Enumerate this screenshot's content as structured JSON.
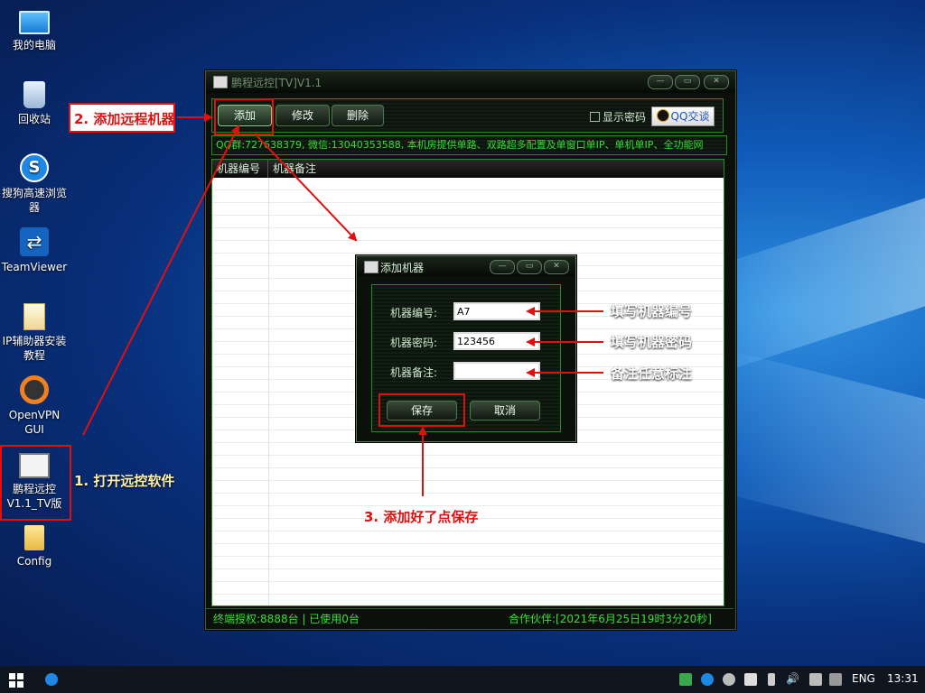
{
  "desktop": {
    "icons": [
      {
        "label": "我的电脑"
      },
      {
        "label": "回收站"
      },
      {
        "label": "搜狗高速浏览器"
      },
      {
        "label": "TeamViewer"
      },
      {
        "label": "IP辅助器安装教程"
      },
      {
        "label": "OpenVPN GUI"
      },
      {
        "label": "鹏程远控V1.1_TV版"
      },
      {
        "label": "Config"
      }
    ]
  },
  "main_window": {
    "title": "鹏程远控[TV]V1.1",
    "toolbar": {
      "add": "添加",
      "edit": "修改",
      "delete": "删除",
      "show_password": "显示密码",
      "qq_chat": "QQ交谈"
    },
    "marquee": "QQ群:727638379, 微信:13040353588, 本机房提供单路、双路超多配置及单窗口单IP、单机单IP、全功能网",
    "columns": [
      "机器编号",
      "机器备注"
    ],
    "status_left": "终端授权:8888台 | 已使用0台",
    "status_right": "合作伙伴:[2021年6月25日19时3分20秒]"
  },
  "dialog": {
    "title": "添加机器",
    "fields": [
      {
        "label": "机器编号:",
        "value": "A7"
      },
      {
        "label": "机器密码:",
        "value": "123456"
      },
      {
        "label": "机器备注:",
        "value": ""
      }
    ],
    "save": "保存",
    "cancel": "取消"
  },
  "annotations": {
    "step1": "1. 打开远控软件",
    "step2": "2. 添加远程机器",
    "step3": "3. 添加好了点保存",
    "fill_id": "填写机器编号",
    "fill_pwd": "填写机器密码",
    "fill_note": "备注任意标注"
  },
  "taskbar": {
    "lang": "ENG",
    "time": "13:31"
  },
  "colors": {
    "annotation_red": "#e01010",
    "app_green": "#33e033"
  }
}
